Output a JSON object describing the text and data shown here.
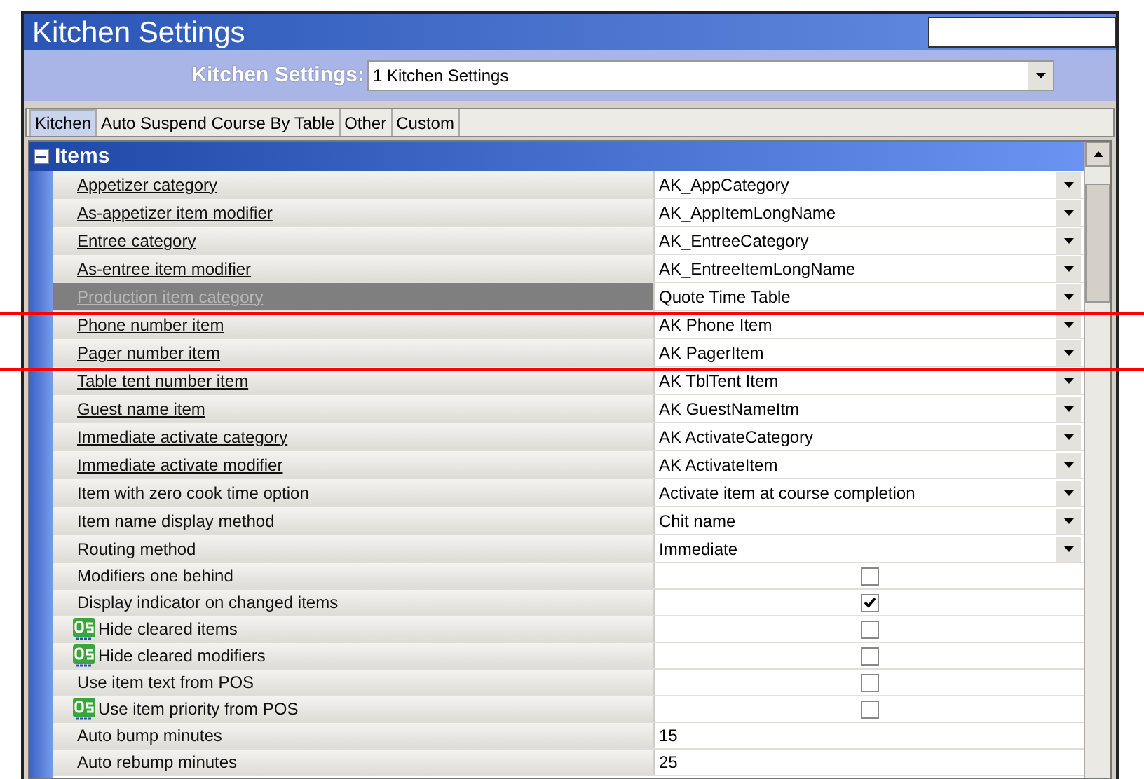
{
  "window": {
    "title": "Kitchen Settings"
  },
  "selector": {
    "label": "Kitchen Settings:",
    "value": "1 Kitchen Settings"
  },
  "tabs": [
    {
      "label": "Kitchen",
      "selected": true
    },
    {
      "label": "Auto Suspend Course By Table",
      "selected": false
    },
    {
      "label": "Other",
      "selected": false
    },
    {
      "label": "Custom",
      "selected": false
    }
  ],
  "section": {
    "title": "Items",
    "expanded": true
  },
  "rows": [
    {
      "label": "Appetizer category",
      "kind": "dropdown",
      "value": "AK_AppCategory",
      "underlined": true,
      "qs": false,
      "selected": false
    },
    {
      "label": "As-appetizer item modifier",
      "kind": "dropdown",
      "value": "AK_AppItemLongName",
      "underlined": true,
      "qs": false,
      "selected": false
    },
    {
      "label": "Entree category",
      "kind": "dropdown",
      "value": "AK_EntreeCategory",
      "underlined": true,
      "qs": false,
      "selected": false
    },
    {
      "label": "As-entree item modifier",
      "kind": "dropdown",
      "value": "AK_EntreeItemLongName",
      "underlined": true,
      "qs": false,
      "selected": false
    },
    {
      "label": "Production item category",
      "kind": "dropdown",
      "value": "Quote Time Table",
      "underlined": true,
      "qs": false,
      "selected": true
    },
    {
      "label": "Phone number item",
      "kind": "dropdown",
      "value": "AK Phone Item",
      "underlined": true,
      "qs": false,
      "selected": false
    },
    {
      "label": "Pager number item",
      "kind": "dropdown",
      "value": "AK PagerItem",
      "underlined": true,
      "qs": false,
      "selected": false
    },
    {
      "label": "Table tent number item",
      "kind": "dropdown",
      "value": "AK TblTent Item",
      "underlined": true,
      "qs": false,
      "selected": false
    },
    {
      "label": "Guest name item",
      "kind": "dropdown",
      "value": "AK GuestNameItm",
      "underlined": true,
      "qs": false,
      "selected": false
    },
    {
      "label": "Immediate activate category",
      "kind": "dropdown",
      "value": "AK ActivateCategory",
      "underlined": true,
      "qs": false,
      "selected": false
    },
    {
      "label": "Immediate activate modifier",
      "kind": "dropdown",
      "value": "AK ActivateItem",
      "underlined": true,
      "qs": false,
      "selected": false
    },
    {
      "label": "Item with zero cook time option",
      "kind": "dropdown",
      "value": "Activate item at course completion",
      "underlined": false,
      "qs": false,
      "selected": false
    },
    {
      "label": "Item name display method",
      "kind": "dropdown",
      "value": "Chit name",
      "underlined": false,
      "qs": false,
      "selected": false
    },
    {
      "label": "Routing method",
      "kind": "dropdown",
      "value": "Immediate",
      "underlined": false,
      "qs": false,
      "selected": false
    },
    {
      "label": "Modifiers one behind",
      "kind": "checkbox",
      "checked": false,
      "underlined": false,
      "qs": false,
      "selected": false
    },
    {
      "label": "Display indicator on changed items",
      "kind": "checkbox",
      "checked": true,
      "underlined": false,
      "qs": false,
      "selected": false
    },
    {
      "label": "Hide cleared items",
      "kind": "checkbox",
      "checked": false,
      "underlined": false,
      "qs": true,
      "selected": false
    },
    {
      "label": "Hide cleared modifiers",
      "kind": "checkbox",
      "checked": false,
      "underlined": false,
      "qs": true,
      "selected": false
    },
    {
      "label": "Use item text from POS",
      "kind": "checkbox",
      "checked": false,
      "underlined": false,
      "qs": false,
      "selected": false
    },
    {
      "label": "Use item priority from POS",
      "kind": "checkbox",
      "checked": false,
      "underlined": false,
      "qs": true,
      "selected": false
    },
    {
      "label": "Auto bump minutes",
      "kind": "text",
      "value": "15",
      "underlined": false,
      "qs": false,
      "selected": false
    },
    {
      "label": "Auto rebump minutes",
      "kind": "text",
      "value": "25",
      "underlined": false,
      "qs": false,
      "selected": false
    }
  ]
}
